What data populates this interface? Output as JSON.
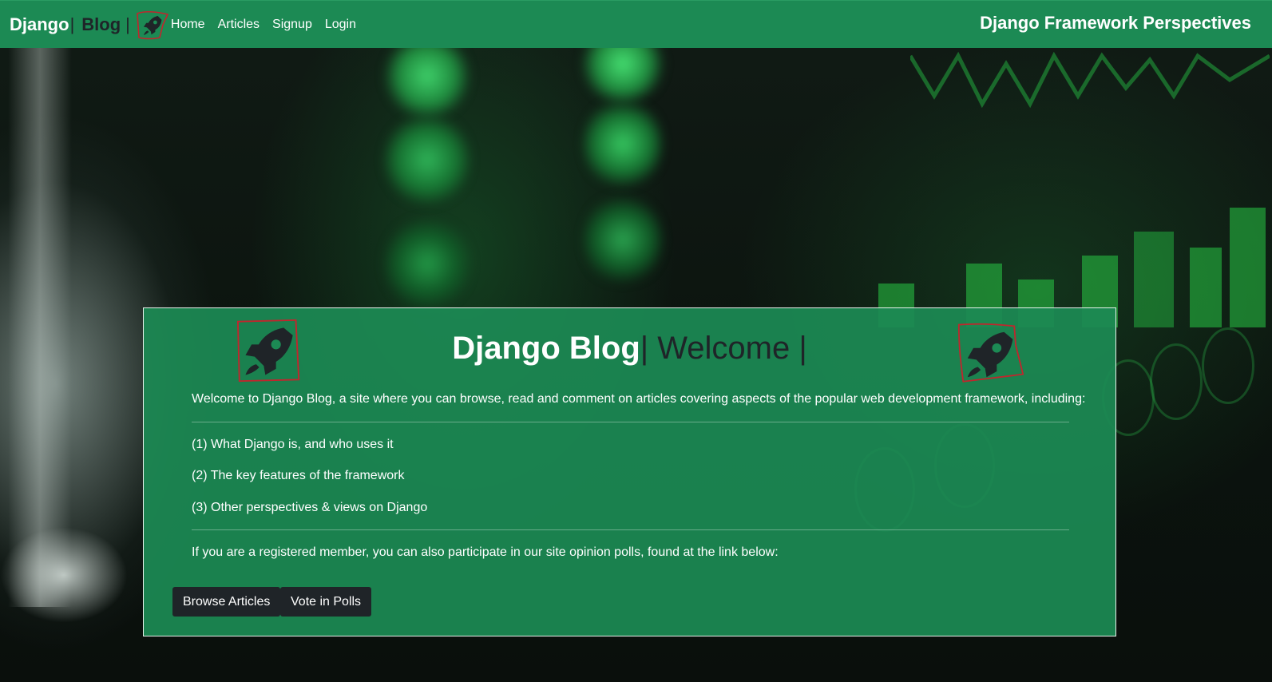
{
  "navbar": {
    "brand_word1": "Django",
    "brand_sep1": "|",
    "brand_word2": "Blog",
    "brand_sep2": "|",
    "links": [
      "Home",
      "Articles",
      "Signup",
      "Login"
    ],
    "right_title": "Django Framework Perspectives"
  },
  "welcome": {
    "title_main": "Django Blog",
    "title_sep": "|",
    "title_welcome": " Welcome |",
    "intro": "Welcome to Django Blog, a site where you can browse, read and comment on articles covering aspects of the popular web development framework, including:",
    "items": [
      "(1) What Django is, and who uses it",
      "(2) The key features of the framework",
      "(3) Other perspectives & views on Django"
    ],
    "polls_note": "If you are a registered member, you can also participate in our site opinion polls, found at the link below:",
    "buttons": {
      "browse": "Browse Articles",
      "vote": "Vote in Polls"
    }
  },
  "colors": {
    "navbar_bg": "#1c8a54",
    "dark_text": "#1f2428",
    "annotation_red": "#c0262d",
    "button_bg": "#1f2428"
  },
  "icons": [
    "rocket-icon"
  ]
}
